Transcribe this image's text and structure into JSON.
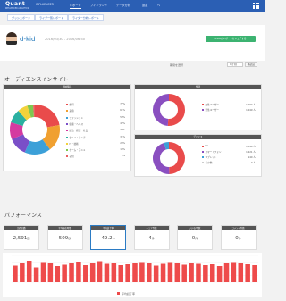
{
  "app": {
    "logo": "Quant",
    "logo_sub": "INFLUENCER ANALYTICS"
  },
  "nav": [
    "INFLUENCER",
    "レポート",
    "フィンランド",
    "データ分析",
    "設定",
    "ヘ"
  ],
  "breadcrumbs": [
    "ダッシュボード",
    "ライブ一覧レポート",
    "ライター分析レポート"
  ],
  "header": {
    "title": "d-kid",
    "range": "2016/03/30 - 2016/06/30",
    "share_button": "d-kidのレポートをシェアする"
  },
  "period": {
    "label": "期間を選択",
    "select": "1ヶ月",
    "button": "再読込"
  },
  "audience": {
    "title": "オーディエンスインサイト",
    "interests": {
      "head": "興味関心",
      "items": [
        {
          "label": "旅行",
          "value": "77%",
          "color": "#e94b4b"
        },
        {
          "label": "美容",
          "value": "61%",
          "color": "#f0a030"
        },
        {
          "label": "ファッション",
          "value": "59%",
          "color": "#3ca0d8"
        },
        {
          "label": "健康・ヘルス",
          "value": "42%",
          "color": "#7a4fc8"
        },
        {
          "label": "政治・経済・社会",
          "value": "38%",
          "color": "#d43aa0"
        },
        {
          "label": "グルメ・ランチ",
          "value": "31%",
          "color": "#2bb0a0"
        },
        {
          "label": "IT・技術",
          "value": "23%",
          "color": "#f2d23c"
        },
        {
          "label": "ゲーム・アニメ",
          "value": "13%",
          "color": "#7ec850"
        },
        {
          "label": "子供",
          "value": "4%",
          "color": "#e86060"
        }
      ]
    },
    "gender": {
      "head": "性別",
      "items": [
        {
          "label": "女性ユーザー",
          "value": "1,097 人",
          "color": "#e94b4b"
        },
        {
          "label": "男性ユーザー",
          "value": "1,049 人",
          "color": "#8a4fc0"
        }
      ]
    },
    "device": {
      "head": "デバイス",
      "items": [
        {
          "label": "PC",
          "value": "1,340 人",
          "color": "#e94b4b"
        },
        {
          "label": "スマートフォン",
          "value": "1,221 人",
          "color": "#8a4fc0"
        },
        {
          "label": "タブレット",
          "value": "140 人",
          "color": "#3ca0d8"
        },
        {
          "label": "その他",
          "value": "0 人",
          "color": "#cccccc"
        }
      ]
    }
  },
  "performance": {
    "title": "パフォーマンス",
    "stats": [
      {
        "label": "訪問回数",
        "value": "2,591",
        "unit": "回"
      },
      {
        "label": "平均滞在時間",
        "value": "509",
        "unit": "秒"
      },
      {
        "label": "平均読了率",
        "value": "49.2",
        "unit": "%"
      },
      {
        "label": "シェア件数",
        "value": "4",
        "unit": "件"
      },
      {
        "label": "いいね!件数",
        "value": "0",
        "unit": "件"
      },
      {
        "label": "コメント件数",
        "value": "0",
        "unit": "件"
      }
    ],
    "chart_legend": "平均読了率"
  },
  "colors": {
    "brand": "#2b5fb4",
    "accent": "#e94b4b",
    "bar": "#ee4b4b"
  },
  "chart_data": {
    "type": "bar",
    "series": [
      {
        "name": "平均読了率",
        "values": [
          37,
          42,
          48,
          33,
          45,
          42,
          36,
          39,
          42,
          46,
          38,
          43,
          47,
          41,
          44,
          38,
          40,
          42,
          45,
          44,
          37,
          41,
          45,
          43,
          39,
          42,
          41,
          38,
          40,
          36,
          42,
          45,
          43,
          40,
          38
        ]
      }
    ],
    "ylim": [
      0,
      60
    ]
  }
}
